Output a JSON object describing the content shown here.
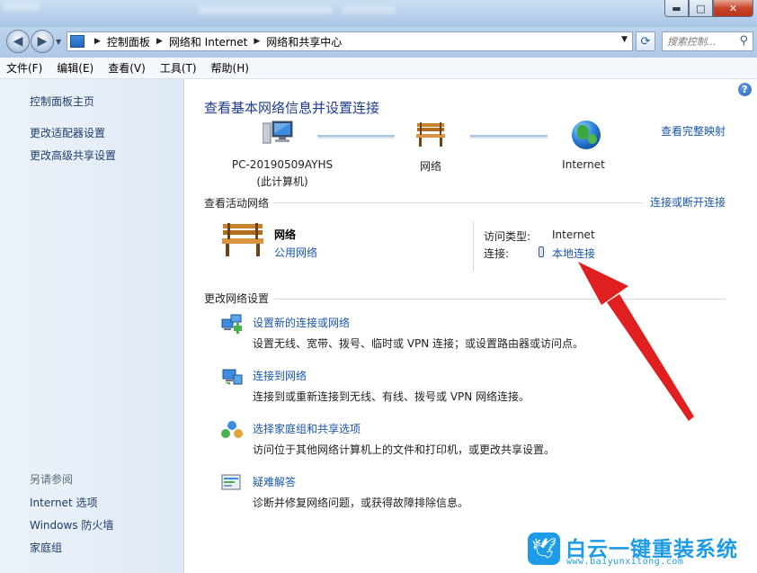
{
  "window": {
    "min_glyph": "▬",
    "max_glyph": "□",
    "close_glyph": "✕"
  },
  "address_bar": {
    "crumbs": [
      "控制面板",
      "网络和 Internet",
      "网络和共享中心"
    ],
    "search_placeholder": "搜索控制..."
  },
  "menu": [
    "文件(F)",
    "编辑(E)",
    "查看(V)",
    "工具(T)",
    "帮助(H)"
  ],
  "sidebar": {
    "items": [
      "控制面板主页",
      "更改适配器设置",
      "更改高级共享设置"
    ],
    "see_also_title": "另请参阅",
    "see_also": [
      "Internet 选项",
      "Windows 防火墙",
      "家庭组"
    ]
  },
  "main": {
    "title": "查看基本网络信息并设置连接",
    "full_map_link": "查看完整映射",
    "map": {
      "computer_name": "PC-20190509AYHS",
      "computer_sub": "(此计算机)",
      "network": "网络",
      "internet": "Internet"
    },
    "active_networks": {
      "heading": "查看活动网络",
      "connect_disconnect": "连接或断开连接",
      "network_name": "网络",
      "network_type": "公用网络",
      "access_type_label": "访问类型:",
      "access_type_value": "Internet",
      "connections_label": "连接:",
      "connections_value": "本地连接"
    },
    "change_settings": {
      "heading": "更改网络设置",
      "tasks": [
        {
          "link": "设置新的连接或网络",
          "desc": "设置无线、宽带、拨号、临时或 VPN 连接；或设置路由器或访问点。"
        },
        {
          "link": "连接到网络",
          "desc": "连接到或重新连接到无线、有线、拨号或 VPN 网络连接。"
        },
        {
          "link": "选择家庭组和共享选项",
          "desc": "访问位于其他网络计算机上的文件和打印机，或更改共享设置。"
        },
        {
          "link": "疑难解答",
          "desc": "诊断并修复网络问题，或获得故障排除信息。"
        }
      ]
    }
  },
  "watermark": {
    "brand": "白云一键重装系统",
    "url": "www.baiyunxitong.com"
  },
  "colors": {
    "link": "#1a56a8",
    "title": "#1e3d8c",
    "arrow": "#e02020",
    "watermark": "#1d9be6"
  }
}
